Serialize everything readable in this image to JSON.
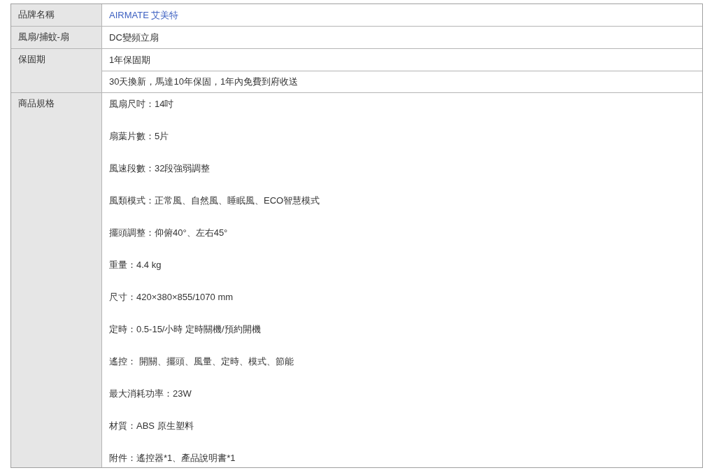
{
  "spec_table": {
    "rows": [
      {
        "label": "品牌名稱",
        "values": [
          {
            "kind": "link",
            "lines": [
              "AIRMATE 艾美特"
            ]
          }
        ]
      },
      {
        "label": "風扇/捕蚊-扇",
        "values": [
          {
            "kind": "text",
            "lines": [
              "DC變頻立扇"
            ]
          }
        ]
      },
      {
        "label": "保固期",
        "values": [
          {
            "kind": "text",
            "lines": [
              "1年保固期"
            ]
          },
          {
            "kind": "text",
            "lines": [
              "30天換新，馬達10年保固，1年內免費到府收送"
            ]
          }
        ]
      },
      {
        "label": "商品規格",
        "values": [
          {
            "kind": "list",
            "lines": [
              "風扇尺吋：14吋",
              "扇葉片數：5片",
              "風速段數：32段強弱調整",
              "風類模式：正常風、自然風、睡眠風、ECO智慧模式",
              "擺頭調整：仰俯40°、左右45°",
              "重量：4.4 kg",
              "尺寸：420×380×855/1070 mm",
              "定時：0.5-15/小時 定時關機/預約開機",
              "遙控： 開關、擺頭、風量、定時、模式、節能",
              "最大消耗功率：23W",
              "材質：ABS 原生塑料",
              "附件：遙控器*1、產品說明書*1"
            ]
          }
        ]
      }
    ]
  }
}
